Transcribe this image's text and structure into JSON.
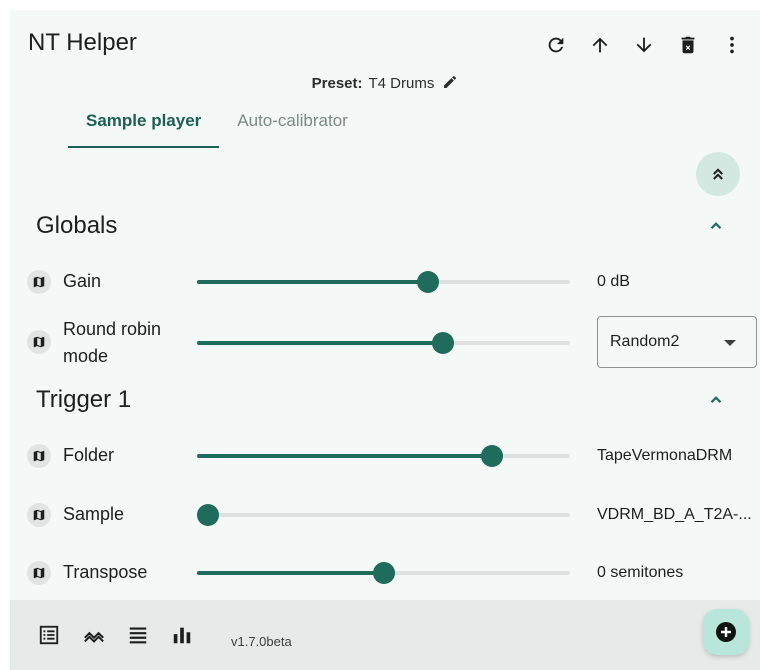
{
  "app": {
    "title": "NT Helper",
    "version": "v1.7.0beta"
  },
  "header_icons": [
    "refresh-icon",
    "arrow-up-icon",
    "arrow-down-icon",
    "delete-icon",
    "more-vert-icon"
  ],
  "preset": {
    "label": "Preset:",
    "value": "T4 Drums"
  },
  "tabs": [
    {
      "label": "Sample player",
      "active": true
    },
    {
      "label": "Auto-calibrator",
      "active": false
    }
  ],
  "globals": {
    "title": "Globals",
    "gain": {
      "label": "Gain",
      "value": "0 dB",
      "level": 0.62
    },
    "round_robin": {
      "label_line1": "Round robin",
      "label_line2": "mode",
      "selected": "Random2",
      "level": 0.66
    }
  },
  "trigger1": {
    "title": "Trigger 1",
    "folder": {
      "label": "Folder",
      "value": "TapeVermonaDRM",
      "level": 0.79
    },
    "sample": {
      "label": "Sample",
      "value": "VDRM_BD_A_T2A-...",
      "level": 0.03
    },
    "transpose": {
      "label": "Transpose",
      "value": "0 semitones",
      "level": 0.5
    }
  },
  "bottom_icons": [
    "list-view-icon",
    "routing-icon",
    "menu-lines-icon",
    "bar-chart-icon"
  ],
  "colors": {
    "accent": "#1f6b5c",
    "background": "#f4f8f6",
    "fab": "#b9e6da"
  }
}
